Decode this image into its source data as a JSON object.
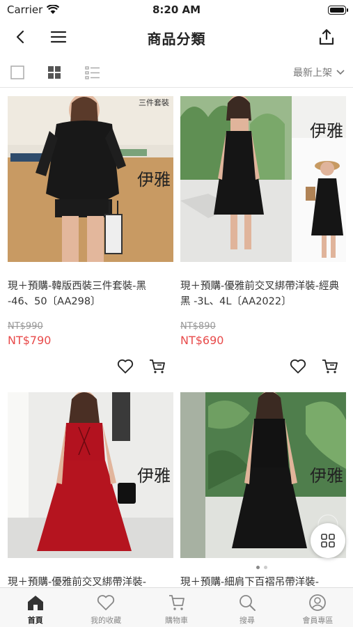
{
  "status": {
    "carrier": "Carrier",
    "time": "8:20 AM"
  },
  "nav": {
    "title": "商品分類"
  },
  "toolbar": {
    "sort_label": "最新上架"
  },
  "products": [
    {
      "title": "現＋預購-韓版西裝三件套裝-黑 -46、50〔AA298〕",
      "old_price": "NT$990",
      "price": "NT$790",
      "photo_tag": "三件套裝",
      "watermark": "伊雅"
    },
    {
      "title": "現＋預購-優雅前交叉綁帶洋裝-經典黑 -3L、4L〔AA2022〕",
      "old_price": "NT$890",
      "price": "NT$690",
      "photo_tag": "",
      "watermark": "伊雅"
    },
    {
      "title": "現＋預購-優雅前交叉綁帶洋裝-",
      "watermark": "伊雅"
    },
    {
      "title": "現＋預購-細肩下百褶吊帶洋裝-",
      "watermark": "伊雅"
    }
  ],
  "tabs": [
    {
      "label": "首頁",
      "icon": "home-icon"
    },
    {
      "label": "我的收藏",
      "icon": "heart-icon"
    },
    {
      "label": "購物車",
      "icon": "cart-icon"
    },
    {
      "label": "搜尋",
      "icon": "search-icon"
    },
    {
      "label": "會員專區",
      "icon": "user-icon"
    }
  ],
  "colors": {
    "price": "#e84a4a",
    "muted": "#999999",
    "tabbar": "#f7f7f7"
  }
}
